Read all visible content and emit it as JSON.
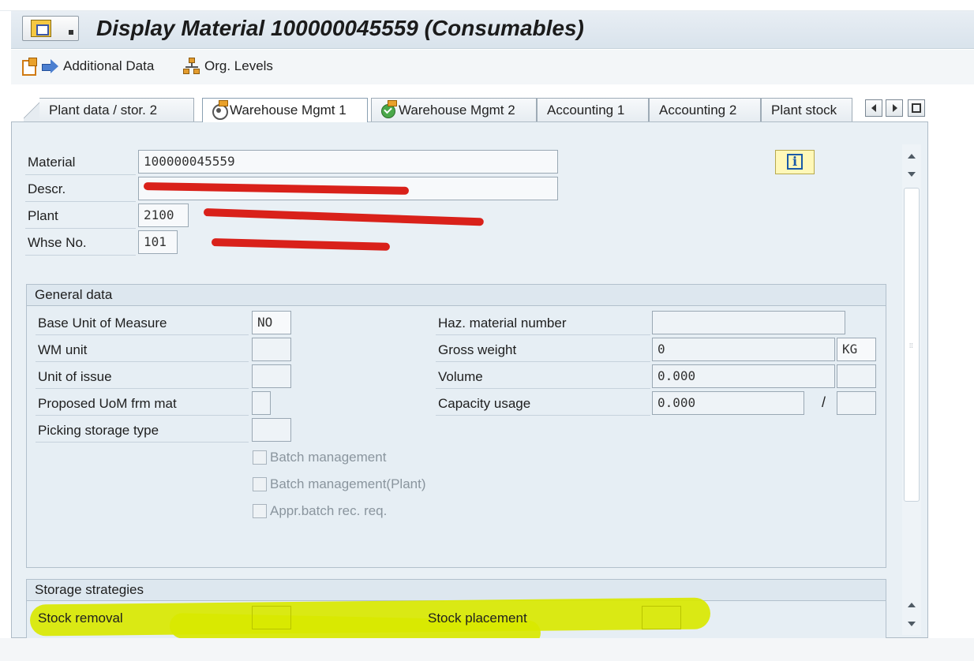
{
  "window": {
    "title": "Display Material 100000045559 (Consumables)"
  },
  "toolbar": {
    "additional_data": "Additional Data",
    "org_levels": "Org. Levels"
  },
  "tabs": [
    {
      "label": "Plant data / stor. 2",
      "active": false
    },
    {
      "label": "Warehouse Mgmt 1",
      "active": true
    },
    {
      "label": "Warehouse Mgmt 2",
      "active": false
    },
    {
      "label": "Accounting 1",
      "active": false
    },
    {
      "label": "Accounting 2",
      "active": false
    },
    {
      "label": "Plant stock",
      "active": false
    }
  ],
  "header_fields": {
    "material_label": "Material",
    "material_value": "100000045559",
    "descr_label": "Descr.",
    "plant_label": "Plant",
    "plant_value": "2100",
    "whse_label": "Whse No.",
    "whse_value": "101"
  },
  "general_data": {
    "title": "General data",
    "base_uom_label": "Base Unit of Measure",
    "base_uom_value": "NO",
    "wm_unit_label": "WM unit",
    "unit_issue_label": "Unit of issue",
    "proposed_uom_label": "Proposed UoM frm mat",
    "picking_storage_label": "Picking storage type",
    "batch_mgmt_label": "Batch management",
    "batch_mgmt_plant_label": "Batch management(Plant)",
    "appr_batch_label": "Appr.batch rec. req.",
    "haz_label": "Haz. material number",
    "gross_weight_label": "Gross weight",
    "gross_weight_value": "0",
    "gross_weight_unit": "KG",
    "volume_label": "Volume",
    "volume_value": "0.000",
    "capacity_label": "Capacity usage",
    "capacity_value": "0.000",
    "capacity_sep": "/"
  },
  "storage_strategies": {
    "title": "Storage strategies",
    "stock_removal_label": "Stock removal",
    "stock_placement_label": "Stock placement"
  },
  "colors": {
    "highlight": "#d9e800",
    "redaction": "#d9211a",
    "panel": "#e9f0f5"
  }
}
